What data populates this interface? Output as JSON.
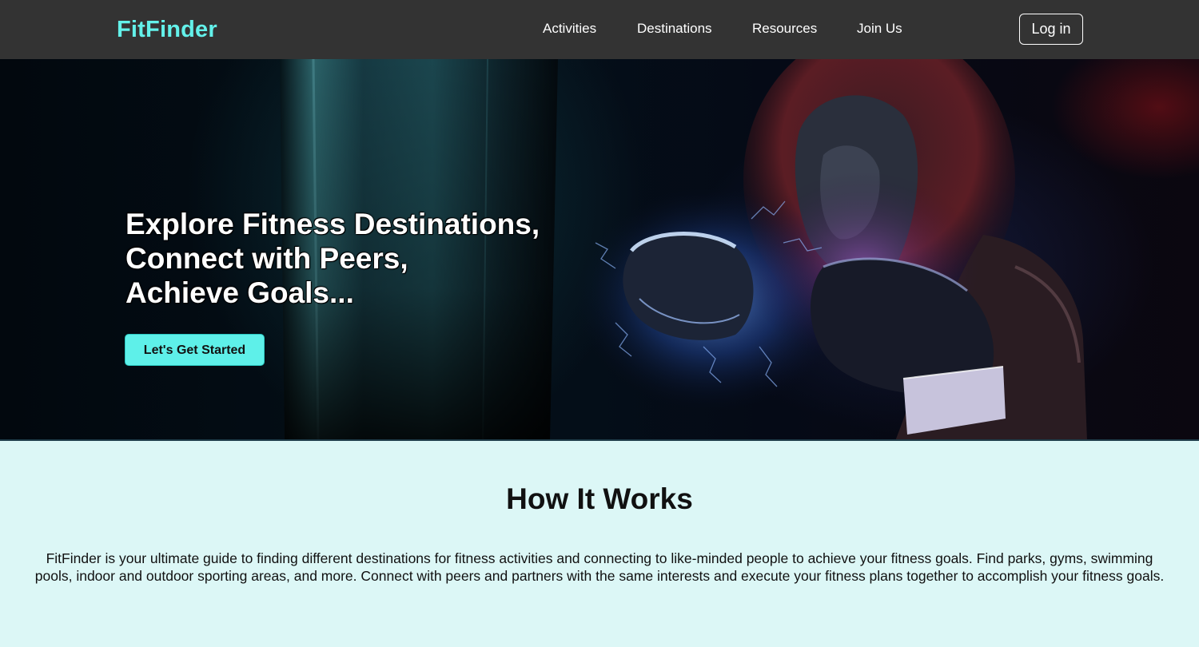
{
  "nav": {
    "logo": "FitFinder",
    "links": [
      "Activities",
      "Destinations",
      "Resources",
      "Join Us"
    ],
    "login_label": "Log in"
  },
  "hero": {
    "title_lines": [
      "Explore Fitness Destinations,",
      "Connect with Peers,",
      "Achieve Goals..."
    ],
    "cta_label": "Let's Get Started"
  },
  "how_it_works": {
    "title": "How It Works",
    "body": "FitFinder is your ultimate guide to finding different destinations for fitness activities and connecting to like-minded people to achieve your fitness goals. Find parks, gyms, swimming pools, indoor and outdoor sporting areas, and more. Connect with peers and partners with the same interests and execute your fitness plans together to accomplish your fitness goals."
  },
  "colors": {
    "nav_bg": "#333333",
    "accent": "#63f1ea",
    "cta_bg": "#5ef0e9",
    "section_bg": "#dcf7f6"
  }
}
